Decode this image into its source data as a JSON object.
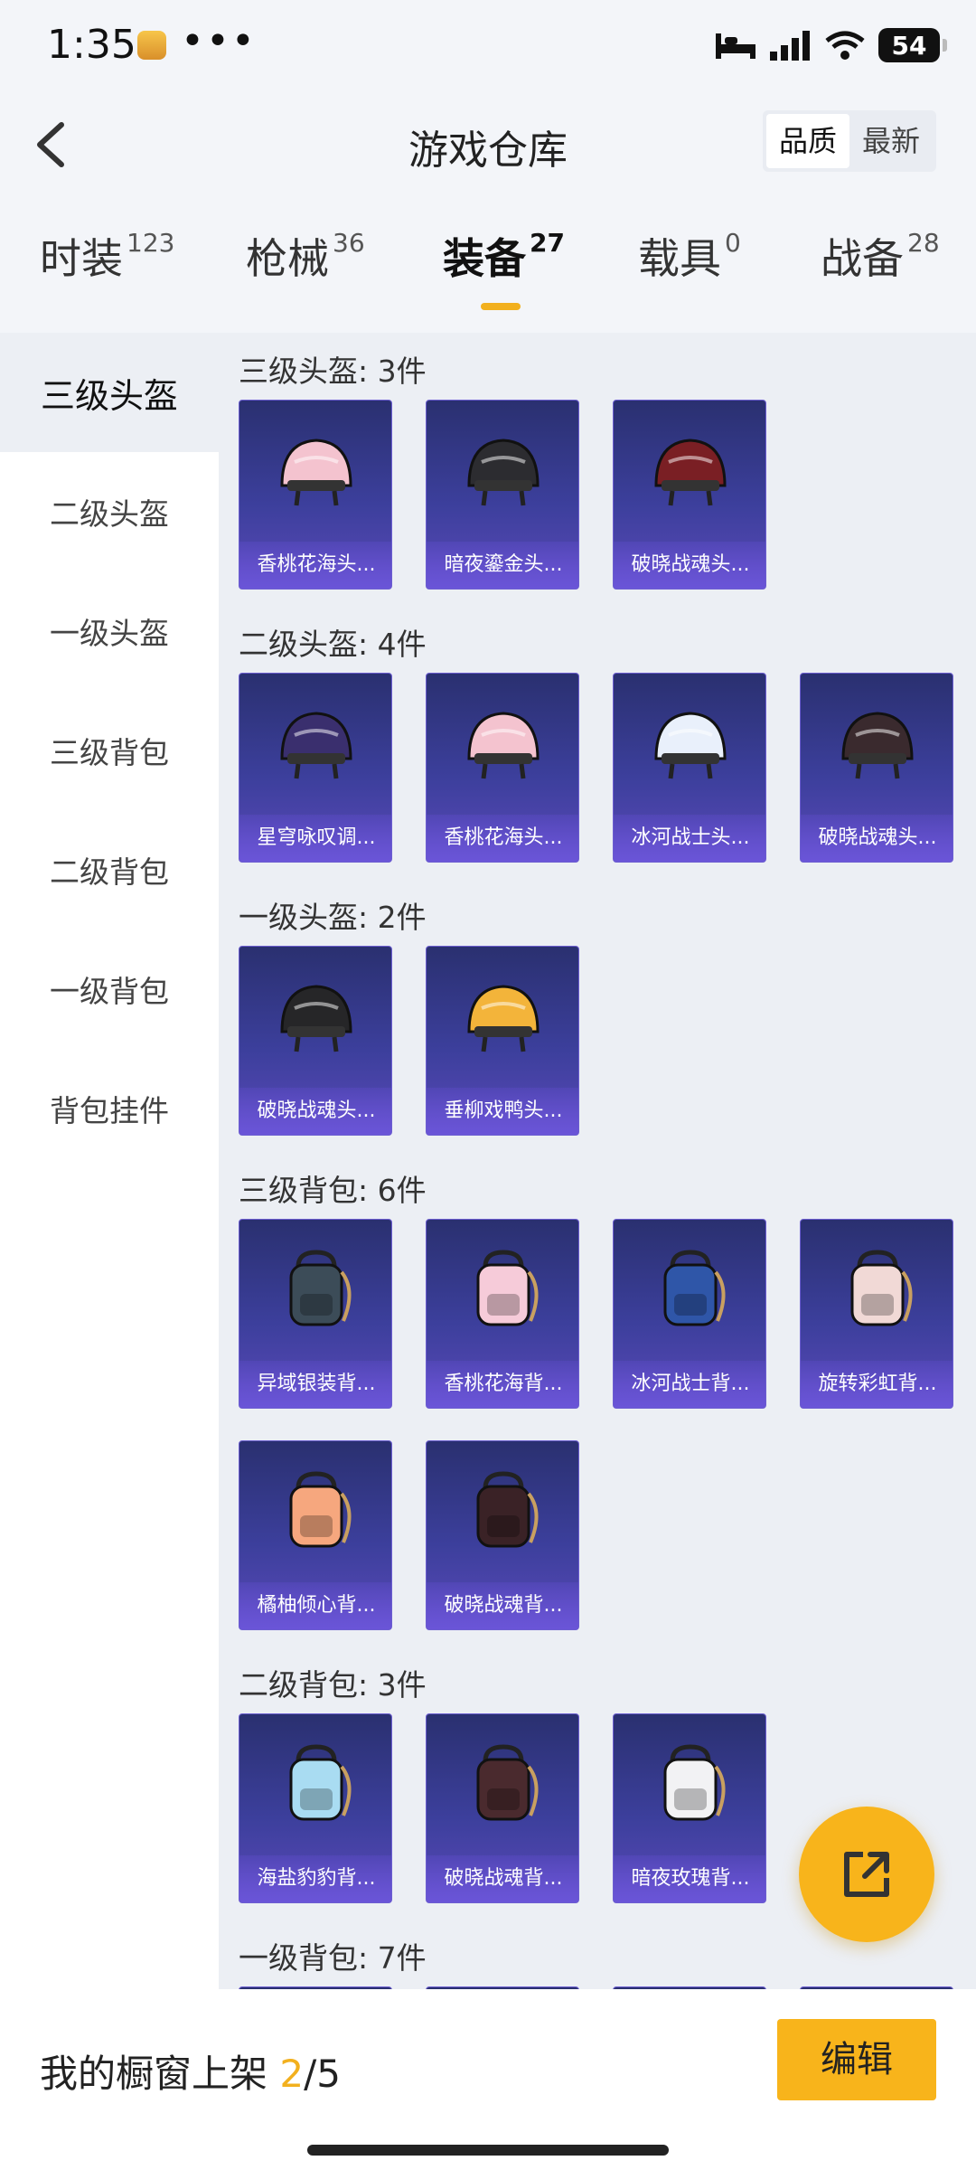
{
  "status": {
    "time": "1:35",
    "dots": "•••",
    "battery": "54"
  },
  "header": {
    "title": "游戏仓库",
    "sort": [
      {
        "label": "品质",
        "active": true
      },
      {
        "label": "最新",
        "active": false
      }
    ]
  },
  "tabs": [
    {
      "label": "时装",
      "count": "123",
      "active": false
    },
    {
      "label": "枪械",
      "count": "36",
      "active": false
    },
    {
      "label": "装备",
      "count": "27",
      "active": true
    },
    {
      "label": "载具",
      "count": "0",
      "active": false
    },
    {
      "label": "战备",
      "count": "28",
      "active": false
    }
  ],
  "sidebar": [
    {
      "label": "三级头盔",
      "active": true
    },
    {
      "label": "二级头盔",
      "active": false
    },
    {
      "label": "一级头盔",
      "active": false
    },
    {
      "label": "三级背包",
      "active": false
    },
    {
      "label": "二级背包",
      "active": false
    },
    {
      "label": "一级背包",
      "active": false
    },
    {
      "label": "背包挂件",
      "active": false
    }
  ],
  "sections": [
    {
      "title": "三级头盔: 3件",
      "items": [
        {
          "name": "香桃花海头...",
          "icon": "helmet-icon",
          "color": "#f4c3cf"
        },
        {
          "name": "暗夜鎏金头...",
          "icon": "helmet-icon",
          "color": "#2c2c30"
        },
        {
          "name": "破晓战魂头...",
          "icon": "helmet-icon",
          "color": "#7a1f24"
        }
      ]
    },
    {
      "title": "二级头盔: 4件",
      "items": [
        {
          "name": "星穹咏叹调...",
          "icon": "helmet-icon",
          "color": "#3a2f6e"
        },
        {
          "name": "香桃花海头...",
          "icon": "helmet-icon",
          "color": "#f4c3cf"
        },
        {
          "name": "冰河战士头...",
          "icon": "helmet-icon",
          "color": "#e9f0fb"
        },
        {
          "name": "破晓战魂头...",
          "icon": "helmet-icon",
          "color": "#3a2a2e"
        }
      ]
    },
    {
      "title": "一级头盔: 2件",
      "items": [
        {
          "name": "破晓战魂头...",
          "icon": "helmet-icon",
          "color": "#262628"
        },
        {
          "name": "垂柳戏鸭头...",
          "icon": "helmet-icon",
          "color": "#f3b43a"
        }
      ]
    },
    {
      "title": "三级背包: 6件",
      "items": [
        {
          "name": "异域银装背...",
          "icon": "backpack-icon",
          "color": "#3c4c58"
        },
        {
          "name": "香桃花海背...",
          "icon": "backpack-icon",
          "color": "#f6cbd9"
        },
        {
          "name": "冰河战士背...",
          "icon": "backpack-icon",
          "color": "#2f56a8"
        },
        {
          "name": "旋转彩虹背...",
          "icon": "backpack-icon",
          "color": "#f1d9d6"
        },
        {
          "name": "橘柚倾心背...",
          "icon": "backpack-icon",
          "color": "#f6a77e"
        },
        {
          "name": "破晓战魂背...",
          "icon": "backpack-icon",
          "color": "#3a2226"
        }
      ]
    },
    {
      "title": "二级背包: 3件",
      "items": [
        {
          "name": "海盐豹豹背...",
          "icon": "backpack-icon",
          "color": "#a9dcf2"
        },
        {
          "name": "破晓战魂背...",
          "icon": "backpack-icon",
          "color": "#4a2a2e"
        },
        {
          "name": "暗夜玫瑰背...",
          "icon": "backpack-icon",
          "color": "#f2f2f4"
        }
      ]
    },
    {
      "title": "一级背包: 7件",
      "items": [
        {
          "name": "",
          "icon": "backpack-icon",
          "color": "#3a3f88"
        },
        {
          "name": "",
          "icon": "backpack-icon",
          "color": "#3a3f88"
        },
        {
          "name": "",
          "icon": "backpack-icon",
          "color": "#3a3f88"
        },
        {
          "name": "",
          "icon": "backpack-icon",
          "color": "#3a3f88"
        }
      ]
    }
  ],
  "bottom": {
    "shelf_prefix": "我的橱窗上架 ",
    "shelf_current": "2",
    "shelf_total": "/5",
    "edit_label": "编辑"
  },
  "colors": {
    "accent": "#f8b41b",
    "card_top": "#2a3070",
    "card_bottom": "#5a49b8"
  }
}
